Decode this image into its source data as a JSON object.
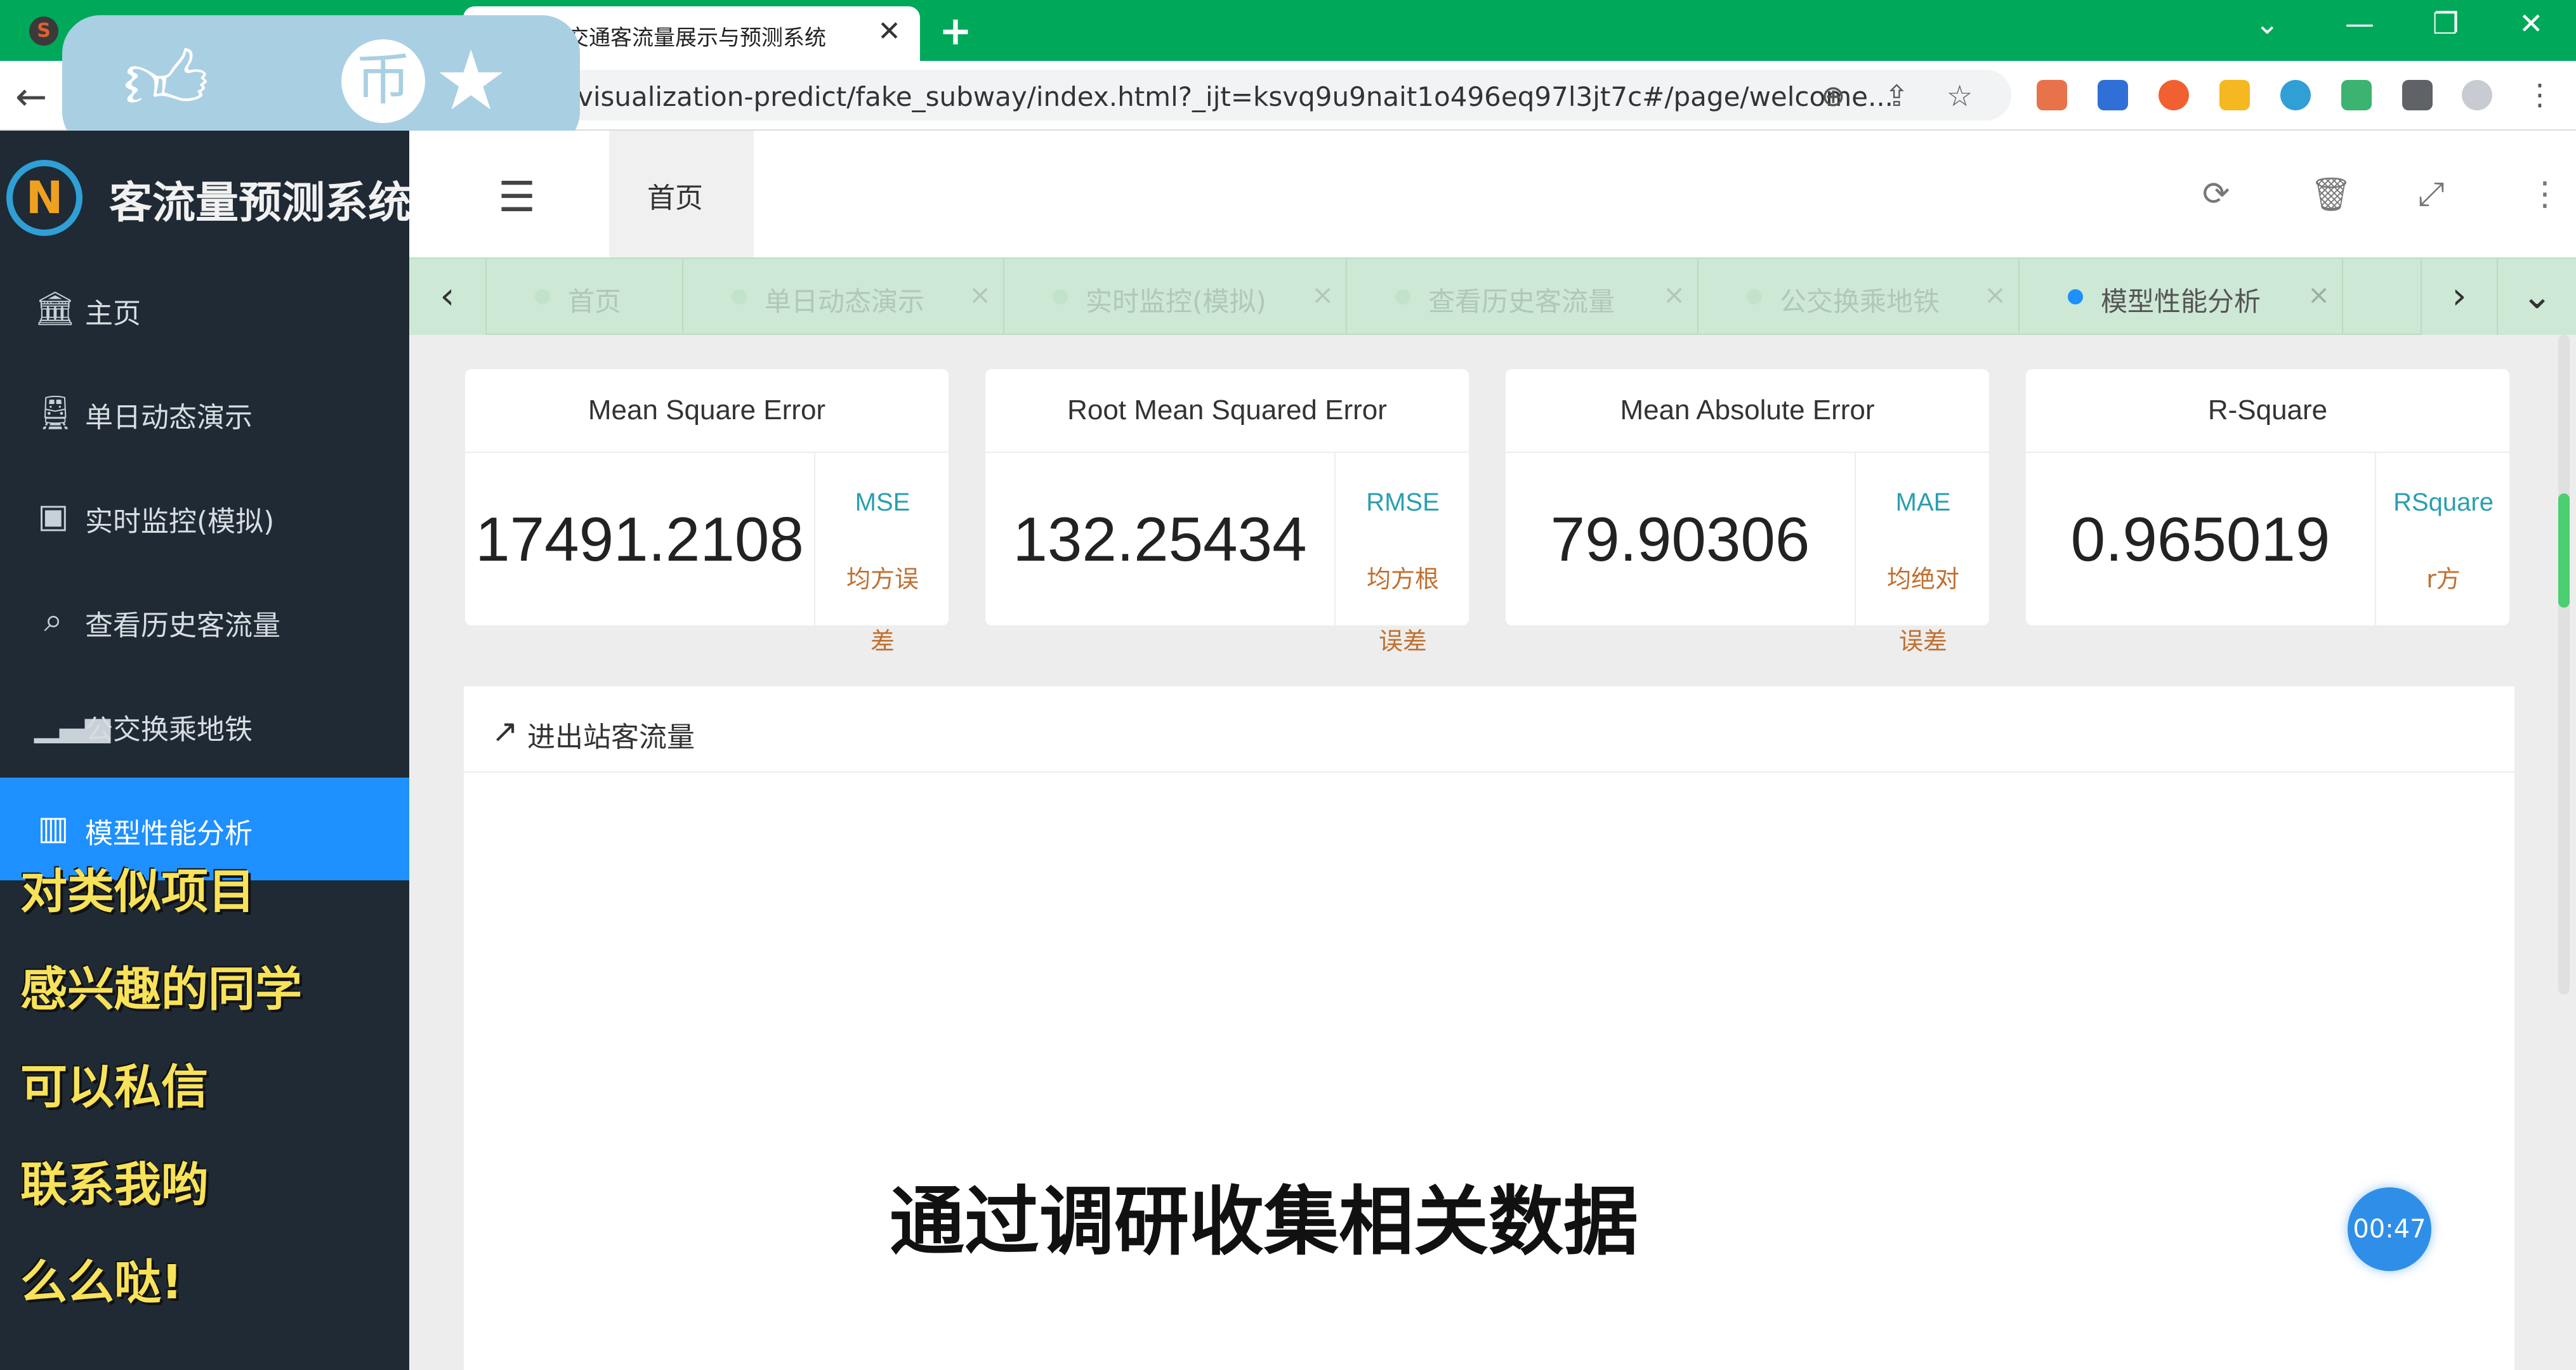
{
  "browser": {
    "tab_title": "道交通客流量展示与预测系统",
    "tab_close": "✕",
    "new_tab": "+",
    "url": "visualization-predict/fake_subway/index.html?_ijt=ksvq9u9nait1o496eq97l3jt7c#/page/welcome...",
    "window_controls": [
      "⌄",
      "—",
      "❐",
      "✕"
    ]
  },
  "overlay": {
    "icons": [
      "thumbs-up-icon",
      "coin-icon",
      "star-icon"
    ],
    "coin_glyph": "币"
  },
  "brand": {
    "logo_letter": "N",
    "title": "客流量预测系统"
  },
  "sidebar": {
    "items": [
      {
        "label": "主页",
        "icon": "bank-icon"
      },
      {
        "label": "单日动态演示",
        "icon": "train-icon"
      },
      {
        "label": "实时监控(模拟)",
        "icon": "monitor-icon"
      },
      {
        "label": "查看历史客流量",
        "icon": "search-icon"
      },
      {
        "label": "公交换乘地铁",
        "icon": "signal-icon"
      },
      {
        "label": "模型性能分析",
        "icon": "bar-chart-icon"
      }
    ]
  },
  "topbar": {
    "home_tab": "首页"
  },
  "page_tabs": [
    {
      "label": "首页",
      "closable": false
    },
    {
      "label": "单日动态演示",
      "closable": true
    },
    {
      "label": "实时监控(模拟)",
      "closable": true
    },
    {
      "label": "查看历史客流量",
      "closable": true
    },
    {
      "label": "公交换乘地铁",
      "closable": true
    },
    {
      "label": "模型性能分析",
      "closable": true
    }
  ],
  "metrics": [
    {
      "title": "Mean Square Error",
      "value": "17491.2108",
      "abbr": "MSE",
      "cn": "均方误差"
    },
    {
      "title": "Root Mean Squared Error",
      "value": "132.25434",
      "abbr": "RMSE",
      "cn": "均方根误差"
    },
    {
      "title": "Mean Absolute Error",
      "value": "79.90306",
      "abbr": "MAE",
      "cn": "均绝对误差"
    },
    {
      "title": "R-Square",
      "value": "0.965019",
      "abbr": "RSquare",
      "cn": "r方"
    }
  ],
  "chart_panel": {
    "title": "进出站客流量"
  },
  "captions": {
    "left": [
      "对类似项目",
      "感兴趣的同学",
      "可以私信",
      "联系我哟",
      "么么哒!"
    ],
    "center": "通过调研收集相关数据"
  },
  "timer": "00:47",
  "colors": {
    "tabstrip": "#00a85a",
    "sidebar": "#1f2a34",
    "active_nav": "#1e90ff",
    "metric_abbr": "#2a9fb0",
    "metric_cn": "#c07030",
    "caption_yellow": "#f7e25a"
  }
}
